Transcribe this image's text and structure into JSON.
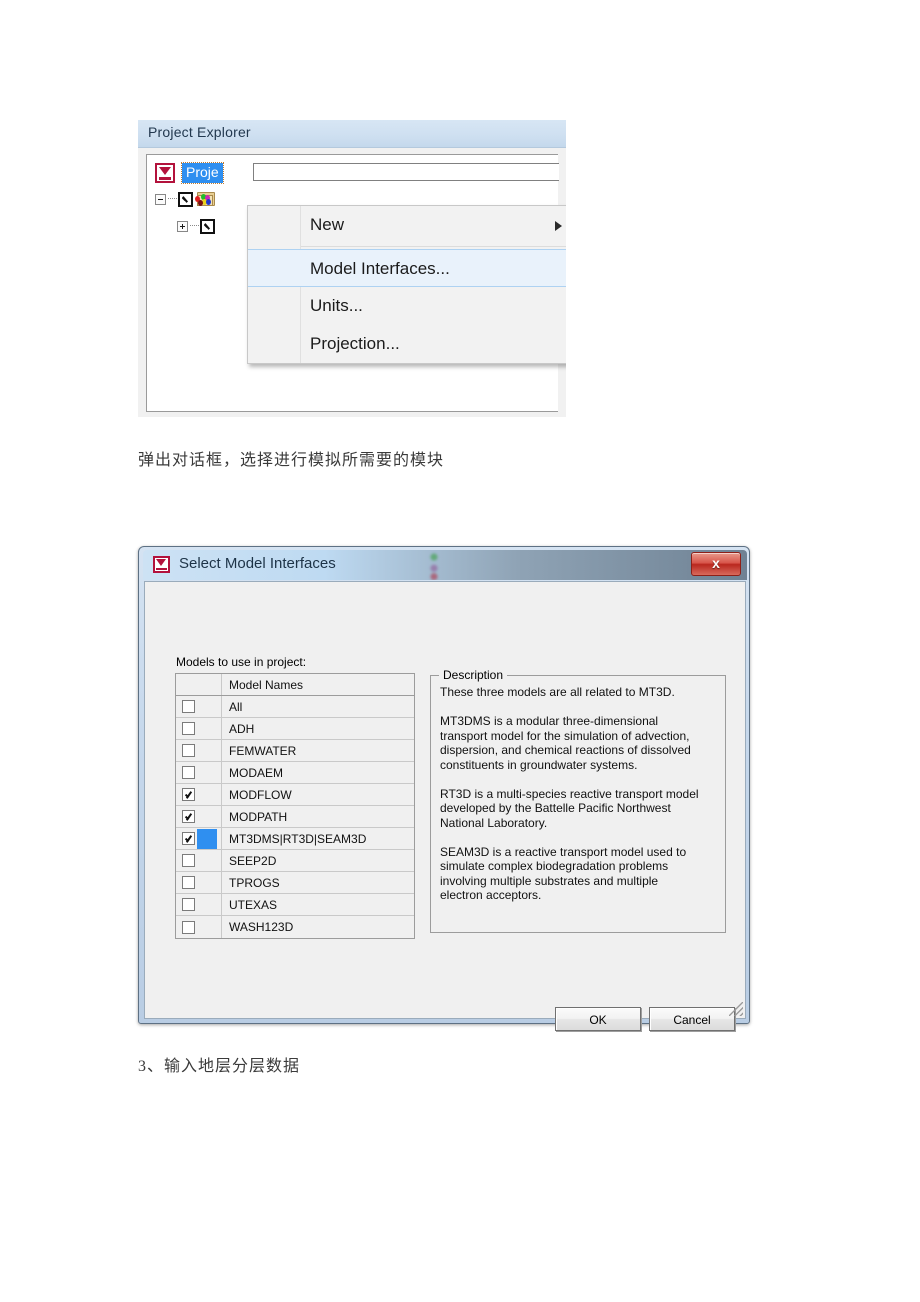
{
  "figure1": {
    "panel_title": "Project Explorer",
    "tree": {
      "root_label": "Proje",
      "root_icon": "gms-project-icon",
      "child1_icon": "folder-colored-icon",
      "child2_icon": "checkbox-icon"
    },
    "context_menu": [
      {
        "label": "New",
        "has_submenu": true,
        "selected": false
      },
      {
        "separator": true
      },
      {
        "label": "Model Interfaces...",
        "has_submenu": false,
        "selected": true
      },
      {
        "label": "Units...",
        "has_submenu": false,
        "selected": false
      },
      {
        "label": "Projection...",
        "has_submenu": false,
        "selected": false
      }
    ]
  },
  "caption1": "弹出对话框，选择进行模拟所需要的模块",
  "caption2": "3、输入地层分层数据",
  "dialog": {
    "title": "Select Model Interfaces",
    "close_label": "x",
    "models_label": "Models to use in project:",
    "table": {
      "header_checkbox_column": "",
      "header_name_column": "Model Names",
      "rows": [
        {
          "name": "All",
          "checked": false,
          "selected": false
        },
        {
          "name": "ADH",
          "checked": false,
          "selected": false
        },
        {
          "name": "FEMWATER",
          "checked": false,
          "selected": false
        },
        {
          "name": "MODAEM",
          "checked": false,
          "selected": false
        },
        {
          "name": "MODFLOW",
          "checked": true,
          "selected": false
        },
        {
          "name": "MODPATH",
          "checked": true,
          "selected": false
        },
        {
          "name": "MT3DMS|RT3D|SEAM3D",
          "checked": true,
          "selected": true
        },
        {
          "name": "SEEP2D",
          "checked": false,
          "selected": false
        },
        {
          "name": "TPROGS",
          "checked": false,
          "selected": false
        },
        {
          "name": "UTEXAS",
          "checked": false,
          "selected": false
        },
        {
          "name": "WASH123D",
          "checked": false,
          "selected": false
        }
      ]
    },
    "description_legend": "Description",
    "description_text": "These three models are all related to MT3D.\n\nMT3DMS is a modular three-dimensional\ntransport model for the simulation of advection,\ndispersion, and chemical reactions of dissolved\nconstituents in groundwater systems.\n\nRT3D is a multi-species reactive transport model\ndeveloped by the Battelle Pacific Northwest\nNational Laboratory.\n\nSEAM3D is a reactive transport model used to\nsimulate complex biodegradation problems\ninvolving multiple substrates and multiple\nelectron acceptors.",
    "ok_label": "OK",
    "cancel_label": "Cancel"
  },
  "colors": {
    "selection_blue": "#2f8ff0",
    "menu_highlight": "#e9f2fb",
    "gms_red": "#b3123c",
    "titlebar_blue": "#cde2f4",
    "close_red": "#b9271e"
  }
}
